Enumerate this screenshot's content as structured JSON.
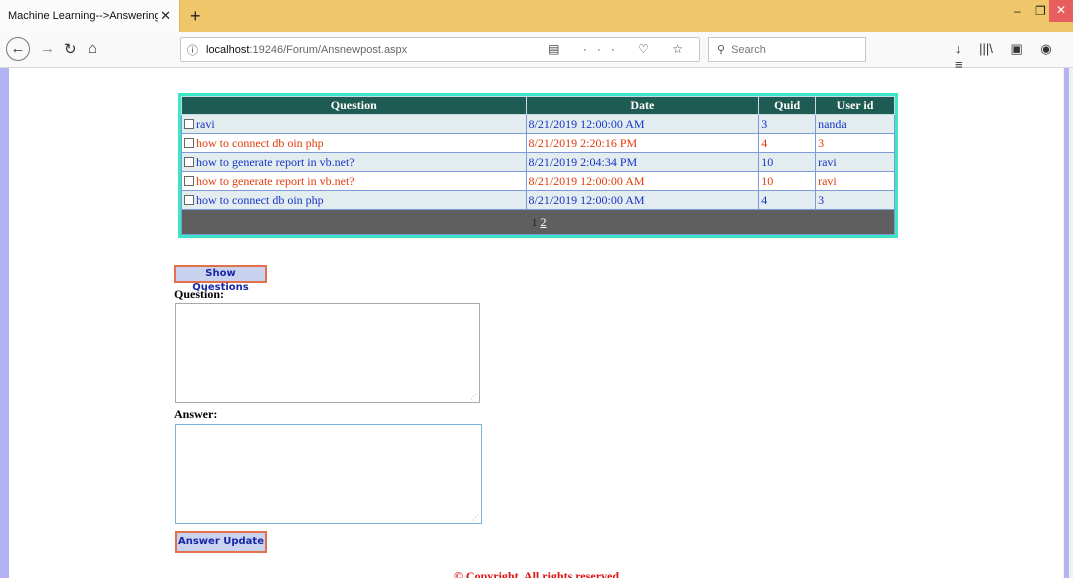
{
  "browser": {
    "tab_title": "Machine Learning-->Answering Ne",
    "tab_close": "✕",
    "new_tab": "+",
    "window_minimize": "–",
    "window_maximize": "❐",
    "window_close": "✕",
    "url_info_icon": "ⓘ",
    "url_host": "localhost",
    "url_path": ":19246/Forum/Ansnewpost.aspx",
    "url_tools": "▤ ··· ♡ ☆",
    "search_placeholder": "Search",
    "toolbar_icons": [
      "↓",
      "|||\\",
      "▣",
      "◉",
      "≡"
    ]
  },
  "grid": {
    "headers": [
      "Question",
      "Date",
      "Quid",
      "User id"
    ],
    "rows": [
      {
        "question": "ravi",
        "date": "8/21/2019 12:00:00 AM",
        "quid": "3",
        "user": "nanda"
      },
      {
        "question": "how to connect db oin php",
        "date": "8/21/2019 2:20:16 PM",
        "quid": "4",
        "user": "3"
      },
      {
        "question": "how to generate report in vb.net?",
        "date": "8/21/2019 2:04:34 PM",
        "quid": "10",
        "user": "ravi"
      },
      {
        "question": "how to generate report in vb.net?",
        "date": "8/21/2019 12:00:00 AM",
        "quid": "10",
        "user": "ravi"
      },
      {
        "question": "how to connect db oin php",
        "date": "8/21/2019 12:00:00 AM",
        "quid": "4",
        "user": "3"
      }
    ],
    "pager": {
      "current": "1",
      "next": "2"
    }
  },
  "form": {
    "show_button": "Show Questions",
    "question_label": "Question:",
    "question_value": "",
    "answer_label": "Answer:",
    "answer_value": "",
    "update_button": "Answer Update"
  },
  "footer": {
    "copyright": "© Copyright. All rights reserved"
  }
}
